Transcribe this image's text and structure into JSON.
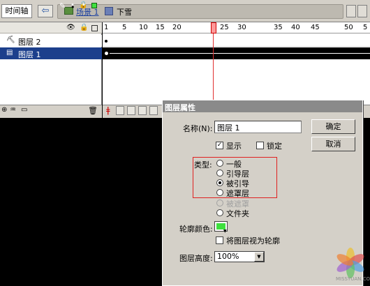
{
  "toolbar": {
    "timeline_tab": "时间轴",
    "scene_label": "场景 1",
    "symbol_label": "下雪"
  },
  "layers": {
    "header": {
      "eye": "eye-icon",
      "lock": "lock-icon",
      "outline": "outline-icon"
    },
    "items": [
      {
        "name": "图层 2",
        "icon": "guide-icon",
        "selected": false,
        "outline_color": "#8020a0"
      },
      {
        "name": "图层 1",
        "icon": "guided-layer-icon",
        "selected": true,
        "outline_color": "#40e040"
      }
    ]
  },
  "ruler": {
    "ticks": [
      "1",
      "5",
      "10",
      "15",
      "20",
      "25",
      "30",
      "35",
      "40",
      "45",
      "50",
      "5"
    ],
    "current_frame": 23
  },
  "dialog": {
    "title": "图层属性",
    "name_label": "名称(N):",
    "name_value": "图层 1",
    "ok": "确定",
    "cancel": "取消",
    "show_label": "显示",
    "show_checked": true,
    "lock_label": "锁定",
    "lock_checked": false,
    "type_label": "类型:",
    "types": [
      {
        "label": "一般",
        "selected": false,
        "disabled": false
      },
      {
        "label": "引导层",
        "selected": false,
        "disabled": false
      },
      {
        "label": "被引导",
        "selected": true,
        "disabled": false
      },
      {
        "label": "遮罩层",
        "selected": false,
        "disabled": false
      },
      {
        "label": "被遮罩",
        "selected": false,
        "disabled": true
      },
      {
        "label": "文件夹",
        "selected": false,
        "disabled": false
      }
    ],
    "outline_color_label": "轮廓颜色:",
    "outline_color": "#3ee03e",
    "view_as_outline_label": "将图层视为轮廓",
    "view_as_outline_checked": false,
    "height_label": "图层高度:",
    "height_value": "100%"
  },
  "watermark": "MISSYUAN.COM"
}
